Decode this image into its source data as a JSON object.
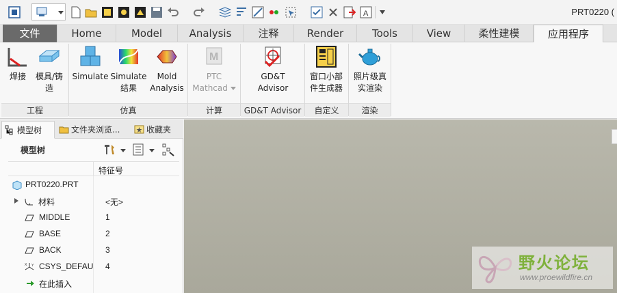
{
  "window": {
    "title": "PRT0220 ("
  },
  "quick_access": {
    "icons": [
      "app-icon",
      "display-icon",
      "dropdown-icon",
      "new-icon",
      "open-icon",
      "regenerate-icon",
      "window-icon",
      "save-icon",
      "undo-icon",
      "redo-icon",
      "layers-icon",
      "sort-icon",
      "draft-icon",
      "color-icon",
      "select-icon",
      "check-icon",
      "close-icon",
      "export-icon",
      "text-icon",
      "customize-icon"
    ]
  },
  "tabs": [
    "文件",
    "Home",
    "Model",
    "Analysis",
    "注释",
    "Render",
    "Tools",
    "View",
    "柔性建模",
    "应用程序"
  ],
  "active_tab": "应用程序",
  "ribbon": {
    "groups": [
      {
        "label": "工程",
        "buttons": [
          {
            "label1": "焊接",
            "label2": ""
          },
          {
            "label1": "模具/铸",
            "label2": "造"
          }
        ]
      },
      {
        "label": "仿真",
        "buttons": [
          {
            "label1": "Simulate",
            "label2": ""
          },
          {
            "label1": "Simulate",
            "label2": "结果"
          },
          {
            "label1": "Mold",
            "label2": "Analysis"
          }
        ]
      },
      {
        "label": "计算",
        "buttons": [
          {
            "label1": "PTC",
            "label2": "Mathcad"
          }
        ]
      },
      {
        "label": "GD&T Advisor",
        "buttons": [
          {
            "label1": "GD&T",
            "label2": "Advisor"
          }
        ]
      },
      {
        "label": "自定义",
        "buttons": [
          {
            "label1": "窗口小部",
            "label2": "件生成器"
          }
        ]
      },
      {
        "label": "渲染",
        "buttons": [
          {
            "label1": "照片级真",
            "label2": "实渲染"
          }
        ]
      }
    ]
  },
  "navigator": {
    "tabs": [
      "模型树",
      "文件夹浏览...",
      "收藏夹"
    ],
    "title": "模型树",
    "column_header": "特征号",
    "rows": [
      {
        "name": "PRT0220.PRT",
        "value": ""
      },
      {
        "name": "材料",
        "value": "<无>"
      },
      {
        "name": "MIDDLE",
        "value": "1"
      },
      {
        "name": "BASE",
        "value": "2"
      },
      {
        "name": "BACK",
        "value": "3"
      },
      {
        "name": "CSYS_DEFAUL",
        "value": "4"
      },
      {
        "name": "在此插入",
        "value": ""
      }
    ]
  },
  "watermark": {
    "title": "野火论坛",
    "url": "www.proewildfire.cn"
  },
  "colors": {
    "file_tab": "#6a6a6a",
    "graphics_bg": "#b2b1a4",
    "watermark_green": "#7fb13c"
  }
}
